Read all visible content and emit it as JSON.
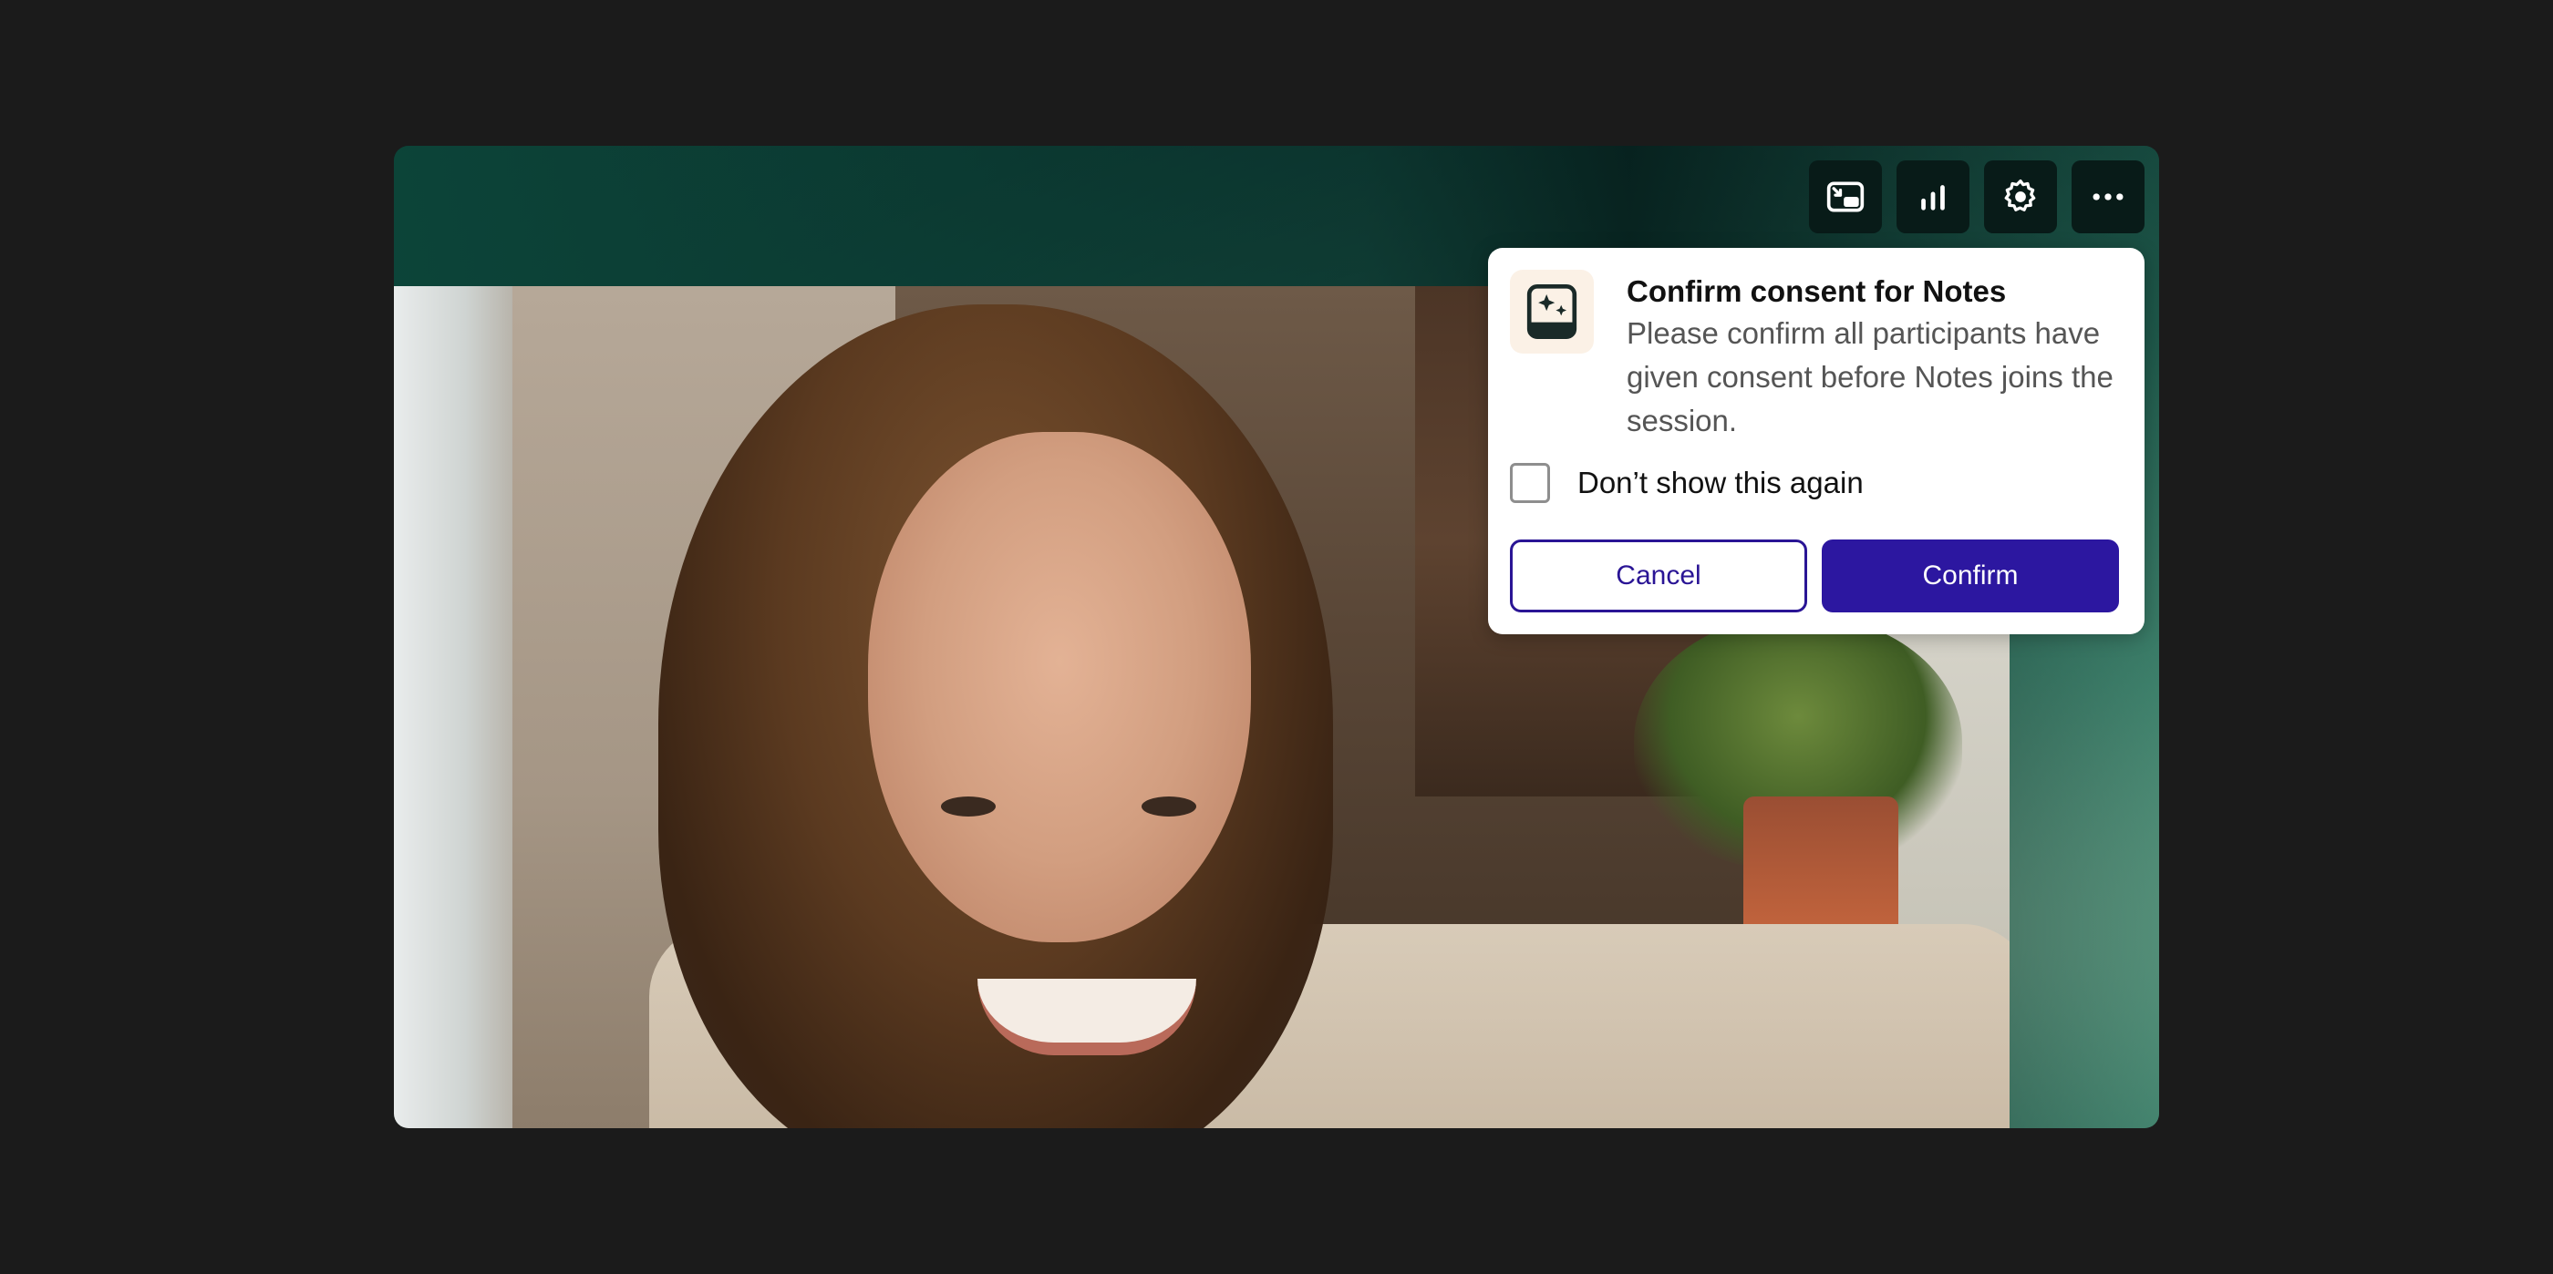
{
  "toolbar": {
    "buttons": [
      {
        "icon": "picture-in-picture-icon"
      },
      {
        "icon": "signal-bars-icon"
      },
      {
        "icon": "gear-icon"
      },
      {
        "icon": "more-options-icon"
      }
    ]
  },
  "dialog": {
    "icon": "notes-sparkle-icon",
    "title": "Confirm consent for Notes",
    "description": "Please confirm all participants have given consent before Notes joins the session.",
    "checkbox_label": "Don’t show this again",
    "checkbox_checked": false,
    "cancel_label": "Cancel",
    "confirm_label": "Confirm"
  },
  "colors": {
    "page_background": "#1b1b1b",
    "primary": "#2c17a0",
    "toolbar_button": "#081b18"
  }
}
